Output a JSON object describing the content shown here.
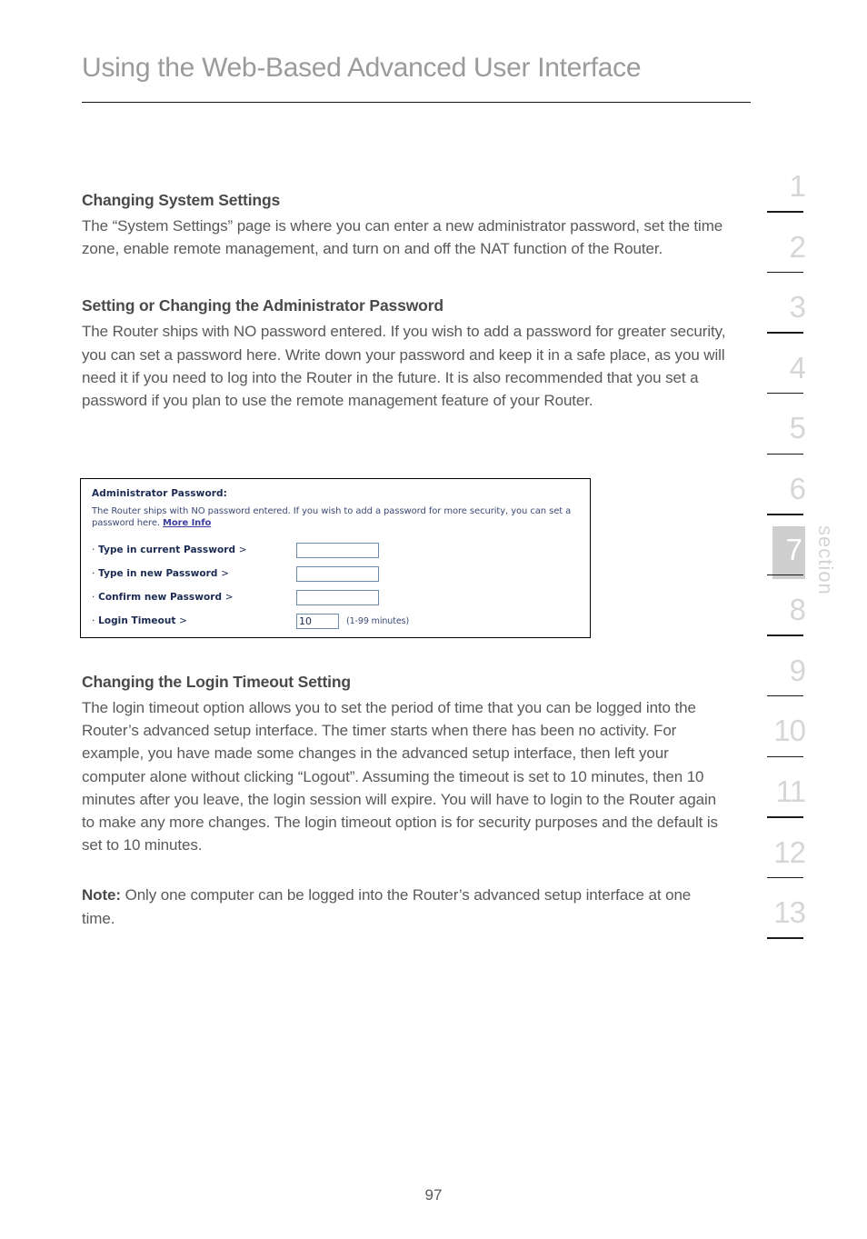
{
  "header": {
    "title": "Using the Web-Based Advanced User Interface"
  },
  "content": {
    "section1": {
      "heading": "Changing System Settings",
      "body": "The “System Settings” page is where you can enter a new administrator password, set the time zone, enable remote management, and turn on and off the NAT function of the Router."
    },
    "section2": {
      "heading": "Setting or Changing the Administrator Password",
      "body": "The Router ships with NO password entered. If you wish to add a password for greater security, you can set a password here. Write down your password and keep it in a safe place, as you will need it if you need to log into the Router in the future. It is also recommended that you set a password if you plan to use the remote management feature of your Router."
    },
    "section3": {
      "heading": "Changing the Login Timeout Setting",
      "body": "The login timeout option allows you to set the period of time that you can be logged into the Router’s advanced setup interface. The timer starts when there has been no activity. For example, you have made some changes in the advanced setup interface, then left your computer alone without clicking “Logout”. Assuming the timeout is set to 10 minutes, then 10 minutes after you leave, the login session will expire. You will have to login to the Router again to make any more changes. The login timeout option is for security purposes and the default is set to 10 minutes."
    },
    "note": {
      "label": "Note:",
      "body": "Only one computer can be logged into the Router’s advanced setup interface at one time."
    }
  },
  "screenshot": {
    "panel_title": "Administrator Password:",
    "description_before_link": "The Router ships with NO password entered. If you wish to add a password for more security, you can set a password here. ",
    "description_link": "More Info",
    "rows": [
      {
        "label_dash": "·",
        "label_text": "Type in current Password",
        "label_gt": ">",
        "value": "",
        "placeholder": "",
        "hint": ""
      },
      {
        "label_dash": "·",
        "label_text": "Type in new Password",
        "label_gt": ">",
        "value": "",
        "placeholder": "",
        "hint": ""
      },
      {
        "label_dash": "·",
        "label_text": "Confirm new Password",
        "label_gt": ">",
        "value": "",
        "placeholder": "",
        "hint": ""
      },
      {
        "label_dash": "·",
        "label_text": "Login Timeout",
        "label_gt": ">",
        "value": "10",
        "placeholder": "",
        "hint": "(1-99 minutes)"
      }
    ]
  },
  "rail": {
    "word": "section",
    "active_index": 6,
    "items": [
      {
        "number": "1"
      },
      {
        "number": "2"
      },
      {
        "number": "3"
      },
      {
        "number": "4"
      },
      {
        "number": "5"
      },
      {
        "number": "6"
      },
      {
        "number": "7"
      },
      {
        "number": "8"
      },
      {
        "number": "9"
      },
      {
        "number": "10"
      },
      {
        "number": "11"
      },
      {
        "number": "12"
      },
      {
        "number": "13"
      }
    ]
  },
  "footer": {
    "page_number": "97"
  },
  "colors": {
    "title_gray": "#9b9b9b",
    "body_gray": "#58595b",
    "heading_gray": "#4a4a4a",
    "rail_gray": "#d6d6d6",
    "rail_chip": "#cecece",
    "ui_navy": "#1b2a52",
    "ui_link": "#3b3f9e",
    "ui_field_border": "#6c8cad"
  }
}
